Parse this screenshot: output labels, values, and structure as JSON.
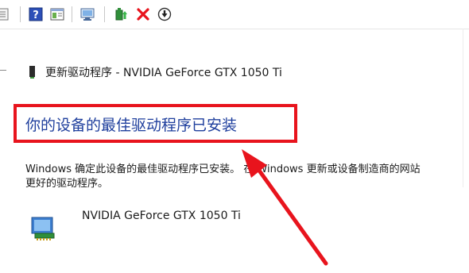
{
  "toolbar": {
    "buttons": [
      {
        "icon": "properties-icon"
      },
      {
        "icon": "help-icon"
      },
      {
        "icon": "view-icon"
      },
      {
        "icon": "scan-hardware-icon"
      },
      {
        "icon": "update-driver-icon"
      },
      {
        "icon": "uninstall-x-icon"
      },
      {
        "icon": "download-circle-icon"
      }
    ]
  },
  "window": {
    "title": "更新驱动程序 - NVIDIA GeForce GTX 1050 Ti"
  },
  "main": {
    "heading": "你的设备的最佳驱动程序已安装",
    "description_line1": "Windows 确定此设备的最佳驱动程序已安装。 在 Windows 更新或设备制造商的网站",
    "description_line2": "更好的驱动程序。",
    "device_name": "NVIDIA GeForce GTX 1050 Ti"
  },
  "colors": {
    "heading": "#1f3f9d",
    "annotation": "#e8141d"
  }
}
